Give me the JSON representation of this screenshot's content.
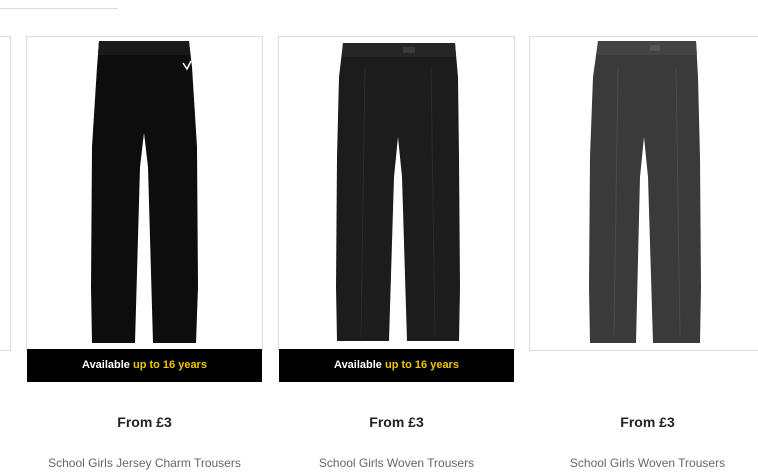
{
  "products": [
    {
      "name": "School Girls Jersey Charm Trousers",
      "price_prefix": "From ",
      "price": "£3",
      "banner": {
        "text": "Available ",
        "highlight": "up to 16 years"
      },
      "image": {
        "description_icon": "black-jersey-trousers-image",
        "color": "#0d0d0d"
      }
    },
    {
      "name": "School Girls Woven Trousers",
      "price_prefix": "From ",
      "price": "£3",
      "banner": {
        "text": "Available ",
        "highlight": "up to 16 years"
      },
      "image": {
        "description_icon": "black-woven-trousers-image",
        "color": "#1c1c1c"
      }
    },
    {
      "name": "School Girls Woven Trousers",
      "price_prefix": "From ",
      "price": "£3",
      "image": {
        "description_icon": "grey-woven-trousers-image",
        "color": "#3a3a3a"
      }
    }
  ],
  "colors": {
    "banner_bg": "#000000",
    "banner_highlight": "#f2c500",
    "border": "#dcdcdc"
  }
}
